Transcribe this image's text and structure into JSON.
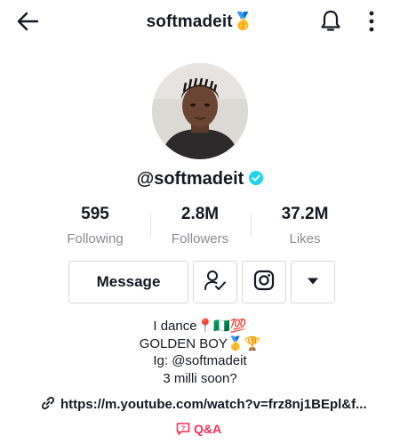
{
  "header": {
    "title": "softmadeit🥇"
  },
  "profile": {
    "username": "@softmadeit"
  },
  "stats": [
    {
      "value": "595",
      "label": "Following"
    },
    {
      "value": "2.8M",
      "label": "Followers"
    },
    {
      "value": "37.2M",
      "label": "Likes"
    }
  ],
  "actions": {
    "message_label": "Message"
  },
  "bio": {
    "line1": "I dance📍🇳🇬💯",
    "line2": "GOLDEN BOY🥇🏆",
    "line3": "Ig: @softmadeit",
    "line4": "3 milli soon?"
  },
  "link": {
    "text": "https://m.youtube.com/watch?v=frz8nj1BEpl&f..."
  },
  "qa": {
    "label": "Q&A"
  },
  "colors": {
    "accent": "#fe2c55",
    "verified": "#20d5ec",
    "muted_text": "#8a8b91"
  }
}
